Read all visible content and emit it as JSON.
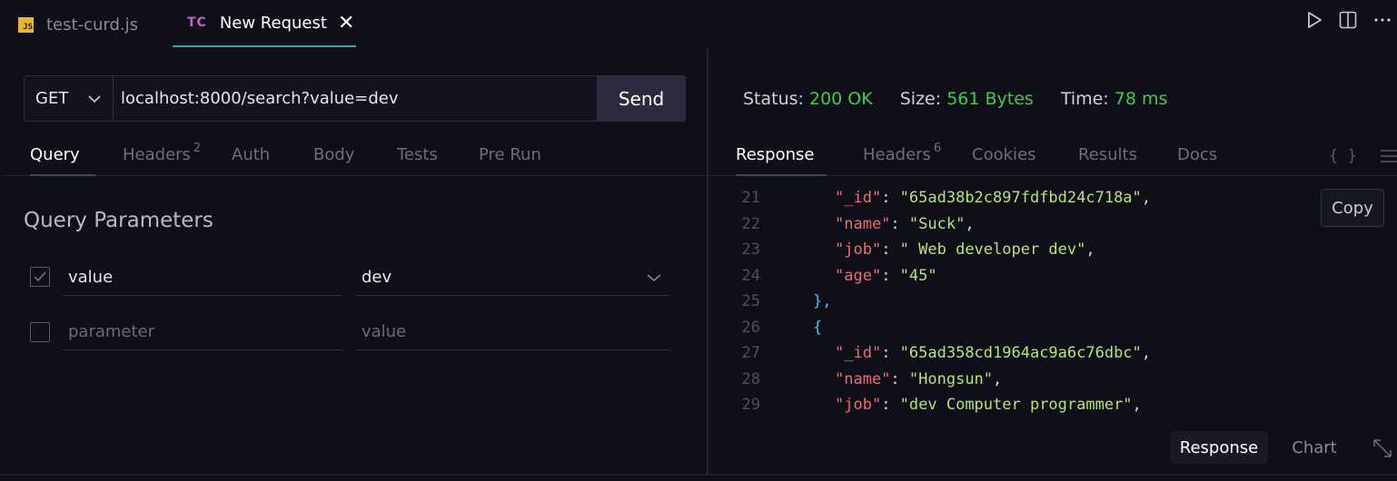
{
  "tabs": [
    {
      "badge": "JS",
      "label": "test-curd.js",
      "active": false
    },
    {
      "badge": "TC",
      "label": "New Request",
      "active": true,
      "close": "✕"
    }
  ],
  "request": {
    "method": "GET",
    "url": "localhost:8000/search?value=dev",
    "send_label": "Send"
  },
  "request_tabs": [
    {
      "label": "Query",
      "active": true,
      "count": ""
    },
    {
      "label": "Headers",
      "active": false,
      "count": "2"
    },
    {
      "label": "Auth",
      "active": false,
      "count": ""
    },
    {
      "label": "Body",
      "active": false,
      "count": ""
    },
    {
      "label": "Tests",
      "active": false,
      "count": ""
    },
    {
      "label": "Pre Run",
      "active": false,
      "count": ""
    }
  ],
  "query": {
    "title": "Query Parameters",
    "rows": [
      {
        "checked": true,
        "name": "value",
        "value": "dev"
      },
      {
        "checked": false,
        "name_placeholder": "parameter",
        "value_placeholder": "value"
      }
    ]
  },
  "status": {
    "status_label": "Status:",
    "status_value": "200 OK",
    "size_label": "Size:",
    "size_value": "561 Bytes",
    "time_label": "Time:",
    "time_value": "78 ms"
  },
  "response_tabs": [
    {
      "label": "Response",
      "active": true,
      "count": ""
    },
    {
      "label": "Headers",
      "active": false,
      "count": "6"
    },
    {
      "label": "Cookies",
      "active": false,
      "count": ""
    },
    {
      "label": "Results",
      "active": false,
      "count": ""
    },
    {
      "label": "Docs",
      "active": false,
      "count": ""
    }
  ],
  "response_icons": {
    "format": "{ }",
    "menu": "menu-icon"
  },
  "code_lines": [
    {
      "n": "21",
      "key": "_id",
      "val": "65ad38b2c897fdfbd24c718a",
      "comma": true
    },
    {
      "n": "22",
      "key": "name",
      "val": "Suck",
      "comma": true
    },
    {
      "n": "23",
      "key": "job",
      "val": " Web developer dev",
      "comma": true
    },
    {
      "n": "24",
      "key": "age",
      "val": "45",
      "comma": false
    },
    {
      "n": "25",
      "brace": "},"
    },
    {
      "n": "26",
      "brace": "{"
    },
    {
      "n": "27",
      "key": "_id",
      "val": "65ad358cd1964ac9a6c76dbc",
      "comma": true
    },
    {
      "n": "28",
      "key": "name",
      "val": "Hongsun",
      "comma": true
    },
    {
      "n": "29",
      "key": "job",
      "val": "dev Computer programmer",
      "comma": true
    }
  ],
  "copy_label": "Copy",
  "view_tabs": {
    "response": "Response",
    "chart": "Chart"
  },
  "colors": {
    "accent_tab": "#3aa6a0",
    "status_ok": "#46c74e",
    "json_key": "#f06a72",
    "json_string": "#b6e27a",
    "json_brace": "#59b8e8"
  }
}
